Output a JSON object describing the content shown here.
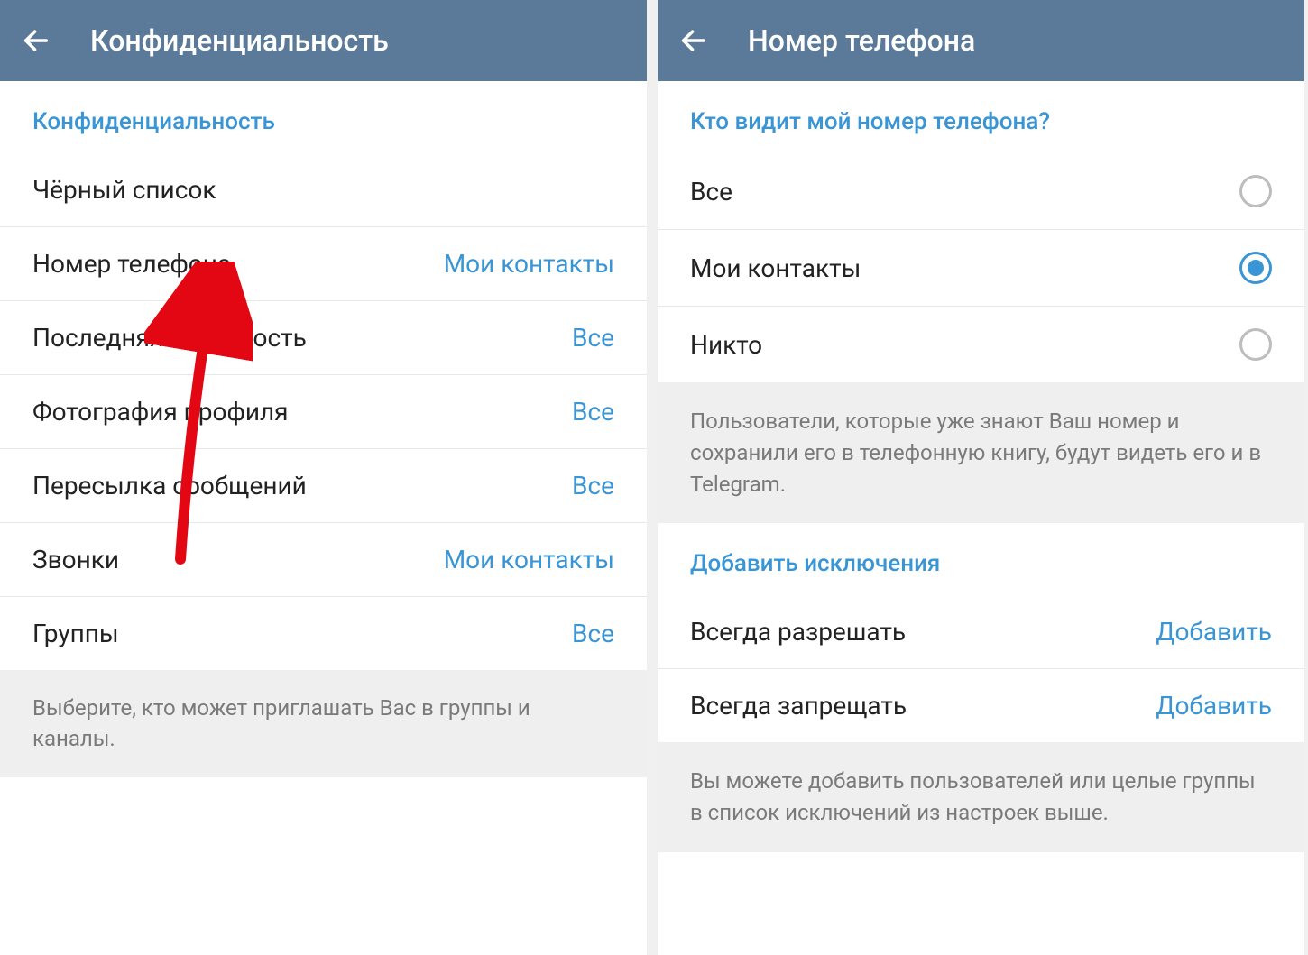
{
  "left": {
    "header": {
      "title": "Конфиденциальность"
    },
    "section_title": "Конфиденциальность",
    "rows": [
      {
        "label": "Чёрный список",
        "value": ""
      },
      {
        "label": "Номер телефона",
        "value": "Мои контакты"
      },
      {
        "label": "Последняя активность",
        "value": "Все"
      },
      {
        "label": "Фотография профиля",
        "value": "Все"
      },
      {
        "label": "Пересылка сообщений",
        "value": "Все"
      },
      {
        "label": "Звонки",
        "value": "Мои контакты"
      },
      {
        "label": "Группы",
        "value": "Все"
      }
    ],
    "footer": "Выберите, кто может приглашать Вас в группы и каналы."
  },
  "right": {
    "header": {
      "title": "Номер телефона"
    },
    "section_title": "Кто видит мой номер телефона?",
    "options": [
      {
        "label": "Все",
        "selected": false
      },
      {
        "label": "Мои контакты",
        "selected": true
      },
      {
        "label": "Никто",
        "selected": false
      }
    ],
    "info1": "Пользователи, которые уже знают Ваш номер и сохранили его в телефонную книгу, будут видеть его и в Telegram.",
    "exceptions_title": "Добавить исключения",
    "exceptions": [
      {
        "label": "Всегда разрешать",
        "action": "Добавить"
      },
      {
        "label": "Всегда запрещать",
        "action": "Добавить"
      }
    ],
    "info2": "Вы можете добавить пользователей или целые группы в список исключений из настроек выше."
  }
}
